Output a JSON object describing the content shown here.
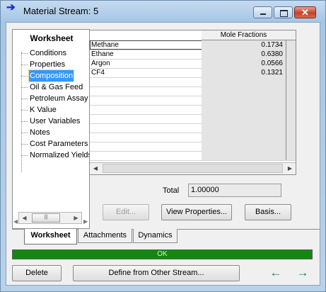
{
  "window": {
    "title": "Material Stream: 5",
    "icon": "arrow-right-icon",
    "close_glyph": "✕"
  },
  "nav": {
    "title": "Worksheet",
    "items": [
      {
        "label": "Conditions"
      },
      {
        "label": "Properties"
      },
      {
        "label": "Composition",
        "selected": true
      },
      {
        "label": "Oil & Gas Feed"
      },
      {
        "label": "Petroleum Assay"
      },
      {
        "label": "K Value"
      },
      {
        "label": "User Variables"
      },
      {
        "label": "Notes"
      },
      {
        "label": "Cost Parameters"
      },
      {
        "label": "Normalized Yields"
      }
    ]
  },
  "grid": {
    "column_header": "Mole Fractions",
    "rows": [
      {
        "component": "Methane",
        "value": "0.1734"
      },
      {
        "component": "Ethane",
        "value": "0.6380"
      },
      {
        "component": "Argon",
        "value": "0.0566"
      },
      {
        "component": "CF4",
        "value": "0.1321"
      }
    ]
  },
  "total": {
    "label": "Total",
    "value": "1.00000"
  },
  "buttons": {
    "edit": "Edit...",
    "view_properties": "View Properties...",
    "basis": "Basis...",
    "delete": "Delete",
    "define_from_other": "Define from Other Stream..."
  },
  "tabs": [
    {
      "label": "Worksheet",
      "active": true
    },
    {
      "label": "Attachments"
    },
    {
      "label": "Dynamics"
    }
  ],
  "status": {
    "text": "OK",
    "color": "#0f8a0f"
  },
  "nav_arrows": {
    "prev": "←",
    "next": "→",
    "color": "#0c7c4a"
  }
}
